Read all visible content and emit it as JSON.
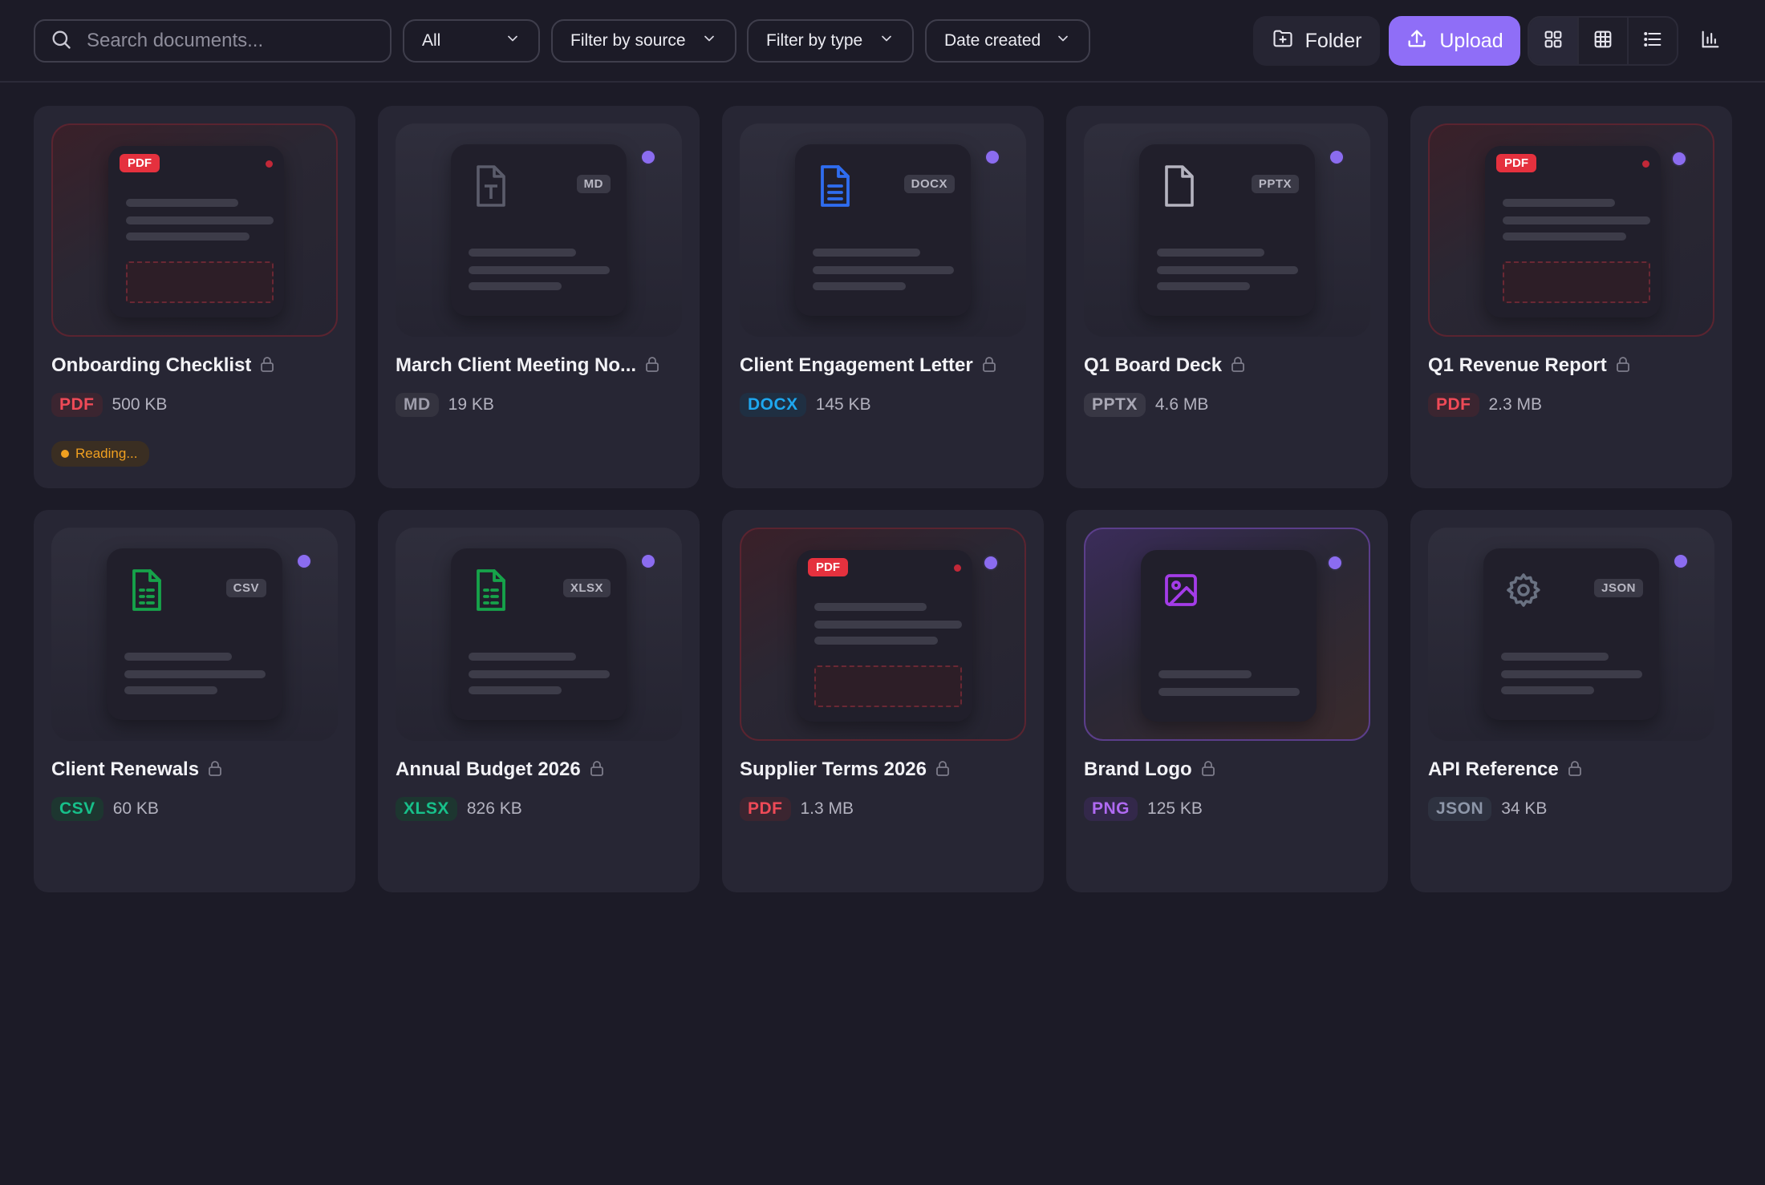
{
  "toolbar": {
    "search_placeholder": "Search documents...",
    "filter_all": "All",
    "filter_source": "Filter by source",
    "filter_type": "Filter by type",
    "sort": "Date created",
    "folder_label": "Folder",
    "upload_label": "Upload",
    "views": [
      "grid-view-icon",
      "table-view-icon",
      "list-view-icon"
    ],
    "active_view": "grid-view-icon",
    "stats_icon": "bar-chart-icon"
  },
  "colors": {
    "accent": "#8f6ef7",
    "pdf": "#e5313e",
    "docx": "#0ea5e9",
    "sheet": "#10b981",
    "image": "#a855f7",
    "neutral": "#9ca3af",
    "reading": "#f0a020"
  },
  "documents": [
    {
      "title": "Onboarding Checklist",
      "type": "PDF",
      "size": "500 KB",
      "status": "Reading...",
      "icon": "pdf-preview",
      "selected": false
    },
    {
      "title": "March Client Meeting No...",
      "type": "MD",
      "size": "19 KB",
      "ext": "MD",
      "icon": "text-file-icon",
      "selected": true
    },
    {
      "title": "Client Engagement Letter",
      "type": "DOCX",
      "size": "145 KB",
      "ext": "DOCX",
      "icon": "document-file-icon",
      "selected": true
    },
    {
      "title": "Q1 Board Deck",
      "type": "PPTX",
      "size": "4.6 MB",
      "ext": "PPTX",
      "icon": "blank-file-icon",
      "selected": true
    },
    {
      "title": "Q1 Revenue Report",
      "type": "PDF",
      "size": "2.3 MB",
      "icon": "pdf-preview",
      "selected": true
    },
    {
      "title": "Client Renewals",
      "type": "CSV",
      "size": "60 KB",
      "ext": "CSV",
      "icon": "spreadsheet-file-icon",
      "selected": true
    },
    {
      "title": "Annual Budget 2026",
      "type": "XLSX",
      "size": "826 KB",
      "ext": "XLSX",
      "icon": "spreadsheet-file-icon",
      "selected": true
    },
    {
      "title": "Supplier Terms 2026",
      "type": "PDF",
      "size": "1.3 MB",
      "icon": "pdf-preview",
      "selected": true
    },
    {
      "title": "Brand Logo",
      "type": "PNG",
      "size": "125 KB",
      "icon": "image-file-icon",
      "selected": true
    },
    {
      "title": "API Reference",
      "type": "JSON",
      "size": "34 KB",
      "ext": "JSON",
      "icon": "gear-icon",
      "selected": true
    }
  ],
  "pdf_badge": "PDF"
}
